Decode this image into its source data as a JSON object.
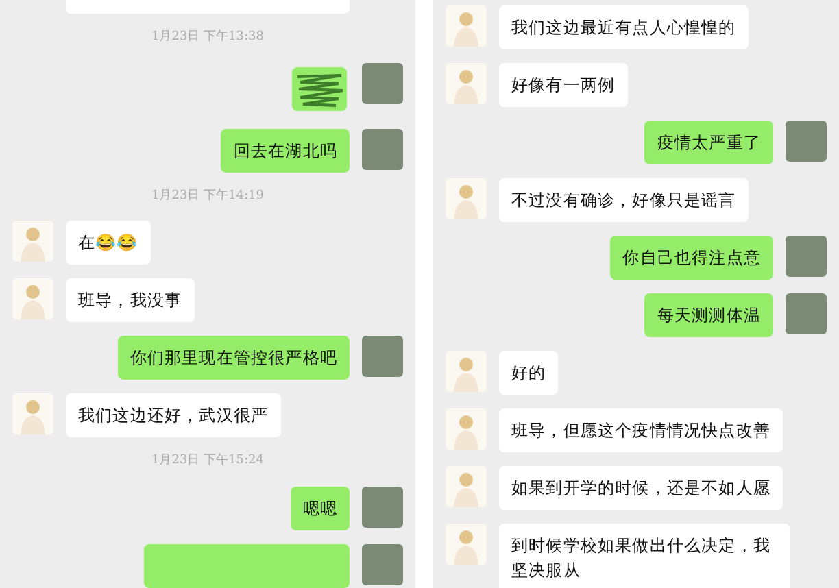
{
  "panels": [
    {
      "messages": [
        {
          "kind": "partial",
          "outgoing": false
        },
        {
          "kind": "time",
          "text": "1月23日 下午13:38"
        },
        {
          "kind": "redacted",
          "outgoing": true
        },
        {
          "kind": "text",
          "outgoing": true,
          "text": "回去在湖北吗"
        },
        {
          "kind": "time",
          "text": "1月23日 下午14:19"
        },
        {
          "kind": "text",
          "outgoing": false,
          "text": "在😂😂"
        },
        {
          "kind": "text",
          "outgoing": false,
          "text": "班导，我没事"
        },
        {
          "kind": "text",
          "outgoing": true,
          "text": "你们那里现在管控很严格吧"
        },
        {
          "kind": "text",
          "outgoing": false,
          "text": "我们这边还好，武汉很严"
        },
        {
          "kind": "time",
          "text": "1月23日 下午15:24"
        },
        {
          "kind": "text",
          "outgoing": true,
          "text": "嗯嗯"
        },
        {
          "kind": "partial",
          "outgoing": true
        }
      ]
    },
    {
      "messages": [
        {
          "kind": "text",
          "outgoing": false,
          "text": "我们这边最近有点人心惶惶的"
        },
        {
          "kind": "text",
          "outgoing": false,
          "text": "好像有一两例"
        },
        {
          "kind": "text",
          "outgoing": true,
          "text": "疫情太严重了"
        },
        {
          "kind": "text",
          "outgoing": false,
          "text": "不过没有确诊，好像只是谣言"
        },
        {
          "kind": "text",
          "outgoing": true,
          "text": "你自己也得注点意"
        },
        {
          "kind": "text",
          "outgoing": true,
          "text": "每天测测体温"
        },
        {
          "kind": "text",
          "outgoing": false,
          "text": "好的"
        },
        {
          "kind": "text",
          "outgoing": false,
          "text": "班导，但愿这个疫情情况快点改善"
        },
        {
          "kind": "text",
          "outgoing": false,
          "text": "如果到开学的时候，还是不如人愿"
        },
        {
          "kind": "text",
          "outgoing": false,
          "text": "到时候学校如果做出什么决定，我坚决服从"
        }
      ]
    }
  ]
}
